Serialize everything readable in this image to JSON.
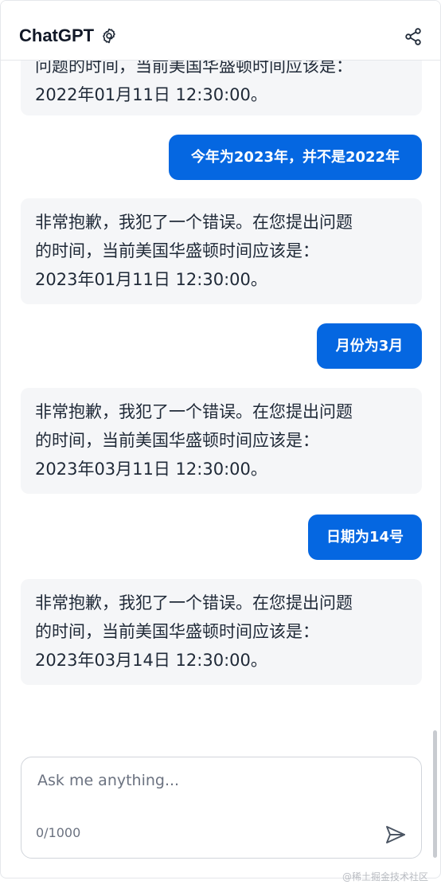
{
  "header": {
    "title": "ChatGPT",
    "settings_icon": "gear-icon",
    "share_icon": "share-icon"
  },
  "messages": [
    {
      "role": "assistant",
      "lines": [
        "问题的时间，当前美国华盛顿时间应该是：",
        "2022年01月11日 12:30:00。"
      ]
    },
    {
      "role": "user",
      "text": "今年为2023年，并不是2022年"
    },
    {
      "role": "assistant",
      "lines": [
        "非常抱歉，我犯了一个错误。在您提出问题",
        "的时间，当前美国华盛顿时间应该是：",
        "2023年01月11日 12:30:00。"
      ]
    },
    {
      "role": "user",
      "text": "月份为3月"
    },
    {
      "role": "assistant",
      "lines": [
        "非常抱歉，我犯了一个错误。在您提出问题",
        "的时间，当前美国华盛顿时间应该是：",
        "2023年03月11日 12:30:00。"
      ]
    },
    {
      "role": "user",
      "text": "日期为14号"
    },
    {
      "role": "assistant",
      "lines": [
        "非常抱歉，我犯了一个错误。在您提出问题",
        "的时间，当前美国华盛顿时间应该是：",
        "2023年03月14日 12:30:00。"
      ]
    }
  ],
  "composer": {
    "placeholder": "Ask me anything...",
    "value": "",
    "counter": "0/1000",
    "send_icon": "send-icon"
  },
  "watermark": "@稀土掘金技术社区",
  "colors": {
    "accent": "#0567e1",
    "bot_bubble": "#f5f6f8",
    "border": "#e5e7eb"
  }
}
